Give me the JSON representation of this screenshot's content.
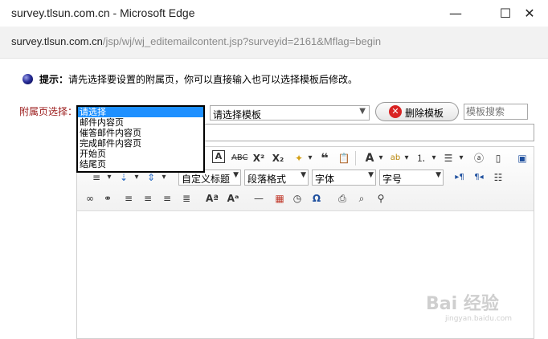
{
  "window": {
    "title": "survey.tlsun.com.cn - Microsoft Edge",
    "min_glyph": "—",
    "max_glyph": "☐",
    "close_glyph": "✕"
  },
  "address": {
    "host": "survey.tlsun.com.cn",
    "path": "/jsp/wj/wj_editemailcontent.jsp?surveyid=2161&Mflag=begin"
  },
  "tip": {
    "label": "提示：",
    "text": "请先选择要设置的附属页，你可以直接输入也可以选择模板后修改。"
  },
  "form": {
    "attach_label": "附属页选择：",
    "attach_options": [
      "请选择",
      "邮件内容页",
      "催答邮件内容页",
      "完成邮件内容页",
      "开始页",
      "结尾页"
    ],
    "attach_selected_index": 0,
    "template_value": "请选择模板",
    "delete_label": "删除模板",
    "search_placeholder": "模板搜索"
  },
  "editor": {
    "format_heading": "自定义标题",
    "paragraph_format": "段落格式",
    "font": "字体",
    "font_size": "字号"
  },
  "watermark": {
    "brand": "Bai 经验",
    "url": "jingyan.baidu.com"
  },
  "colors": {
    "label_red": "#9b1b1b",
    "selection_blue": "#1e90ff",
    "delete_icon": "#d92323"
  }
}
